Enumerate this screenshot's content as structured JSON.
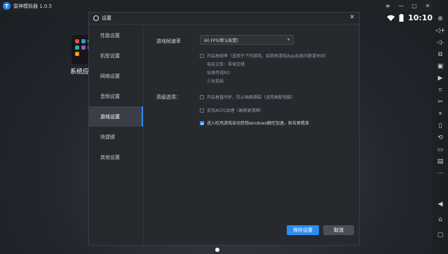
{
  "titlebar": {
    "logo_glyph": "T",
    "title": "雷神模拟器 1.0.5"
  },
  "window_controls": [
    "≡",
    "—",
    "▢",
    "✕"
  ],
  "statusbar": {
    "time": "10:10",
    "wifi_icon": "wifi-icon",
    "battery_icon": "battery-icon"
  },
  "desktop": {
    "app_label": "系统应用"
  },
  "dialog": {
    "title": "设置",
    "close": "✕",
    "nav": [
      {
        "label": "性能设置",
        "active": false
      },
      {
        "label": "机型设置",
        "active": false
      },
      {
        "label": "网络设置",
        "active": false
      },
      {
        "label": "音频设置",
        "active": false
      },
      {
        "label": "游戏设置",
        "active": true
      },
      {
        "label": "快捷键",
        "active": false
      },
      {
        "label": "其他设置",
        "active": false
      }
    ],
    "fps": {
      "label": "游戏帧速率",
      "value": "60 FPS(默认配置)"
    },
    "high_fps": {
      "text": "开启高帧率（适用于下列游戏，如其他游戏App出现问题请关闭）",
      "checked": false,
      "games": [
        "电击文库：零境交错",
        "仙境传说RO",
        "少女前线"
      ]
    },
    "advanced": {
      "label": "高级选项：",
      "options": [
        {
          "text": "开启垂直同步，防止画面撕裂（适用高配电脑）",
          "checked": false
        },
        {
          "text": "支持ASTC纹理（画质更清晰）",
          "checked": false
        },
        {
          "text": "进入吃鸡游戏自动禁用windows触控加速，射击更精准",
          "checked": true
        }
      ]
    },
    "save_label": "保存设置",
    "cancel_label": "取消"
  },
  "colors": {
    "accent": "#2d8cf0",
    "dialog_bg": "#26292e",
    "nav_active": "#3a3f47"
  }
}
